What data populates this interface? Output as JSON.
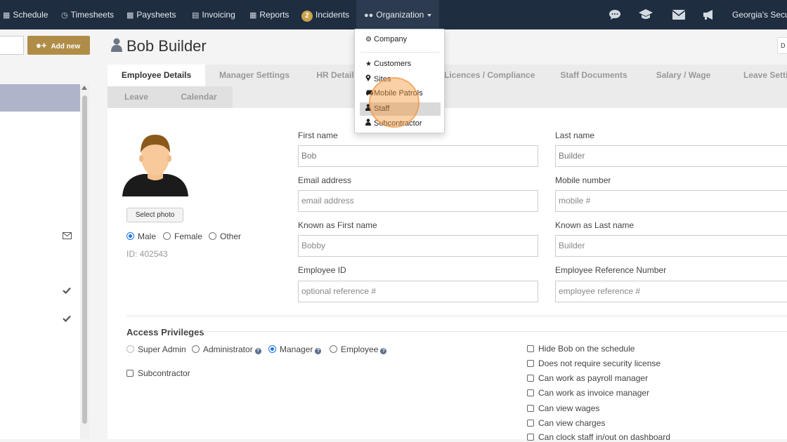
{
  "nav": {
    "items": [
      {
        "label": "Schedule",
        "icon": "calendar-icon"
      },
      {
        "label": "Timesheets",
        "icon": "clock-icon"
      },
      {
        "label": "Paysheets",
        "icon": "money-icon"
      },
      {
        "label": "Invoicing",
        "icon": "invoice-icon"
      },
      {
        "label": "Reports",
        "icon": "table-icon"
      },
      {
        "label": "Incidents",
        "badge": "2"
      },
      {
        "label": "Organization",
        "icon": "users-icon"
      }
    ],
    "account": "Georgia's Securi",
    "right_icons": [
      "chat-icon",
      "graduation-cap-icon",
      "envelope-icon",
      "megaphone-icon"
    ]
  },
  "sidebar": {
    "add_new_label": "Add new"
  },
  "page": {
    "title": "Bob Builder",
    "corner_btn": "D"
  },
  "tabs": {
    "row1": [
      "Employee Details",
      "Manager Settings",
      "HR Detail",
      "Licences / Compliance",
      "Staff Documents",
      "Salary / Wage",
      "Leave Settin"
    ],
    "row2": [
      "Leave",
      "Calendar"
    ]
  },
  "profile": {
    "select_photo": "Select photo",
    "gender_options": [
      "Male",
      "Female",
      "Other"
    ],
    "gender_selected": "Male",
    "id_text": "ID: 402543"
  },
  "form": {
    "first_name": {
      "label": "First name",
      "value": "Bob"
    },
    "last_name": {
      "label": "Last name",
      "value": "Builder"
    },
    "email": {
      "label": "Email address",
      "placeholder": "email address"
    },
    "mobile": {
      "label": "Mobile number",
      "placeholder": "mobile #"
    },
    "known_first": {
      "label": "Known as First name",
      "placeholder": "Bobby"
    },
    "known_last": {
      "label": "Known as Last name",
      "placeholder": "Builder"
    },
    "employee_id": {
      "label": "Employee ID",
      "placeholder": "optional reference #"
    },
    "employee_ref": {
      "label": "Employee Reference Number",
      "placeholder": "employee reference #"
    }
  },
  "access": {
    "title": "Access Privileges",
    "roles": [
      "Super Admin",
      "Administrator",
      "Manager",
      "Employee"
    ],
    "role_selected": "Manager",
    "subcontractor": "Subcontractor",
    "checkboxes": [
      "Hide Bob on the schedule",
      "Does not require security license",
      "Can work as payroll manager",
      "Can work as invoice manager",
      "Can view wages",
      "Can view charges",
      "Can clock staff in/out on dashboard"
    ]
  },
  "org_dropdown": {
    "items": [
      {
        "label": "Company",
        "icon": "gear-icon"
      },
      {
        "label": "Customers",
        "icon": "star-icon"
      },
      {
        "label": "Sites",
        "icon": "map-marker-icon"
      },
      {
        "label": "Mobile Patrols",
        "icon": "car-icon"
      },
      {
        "label": "Staff",
        "icon": "user-icon"
      },
      {
        "label": "Subcontractor",
        "icon": "user-icon"
      }
    ],
    "highlighted": "Staff"
  }
}
